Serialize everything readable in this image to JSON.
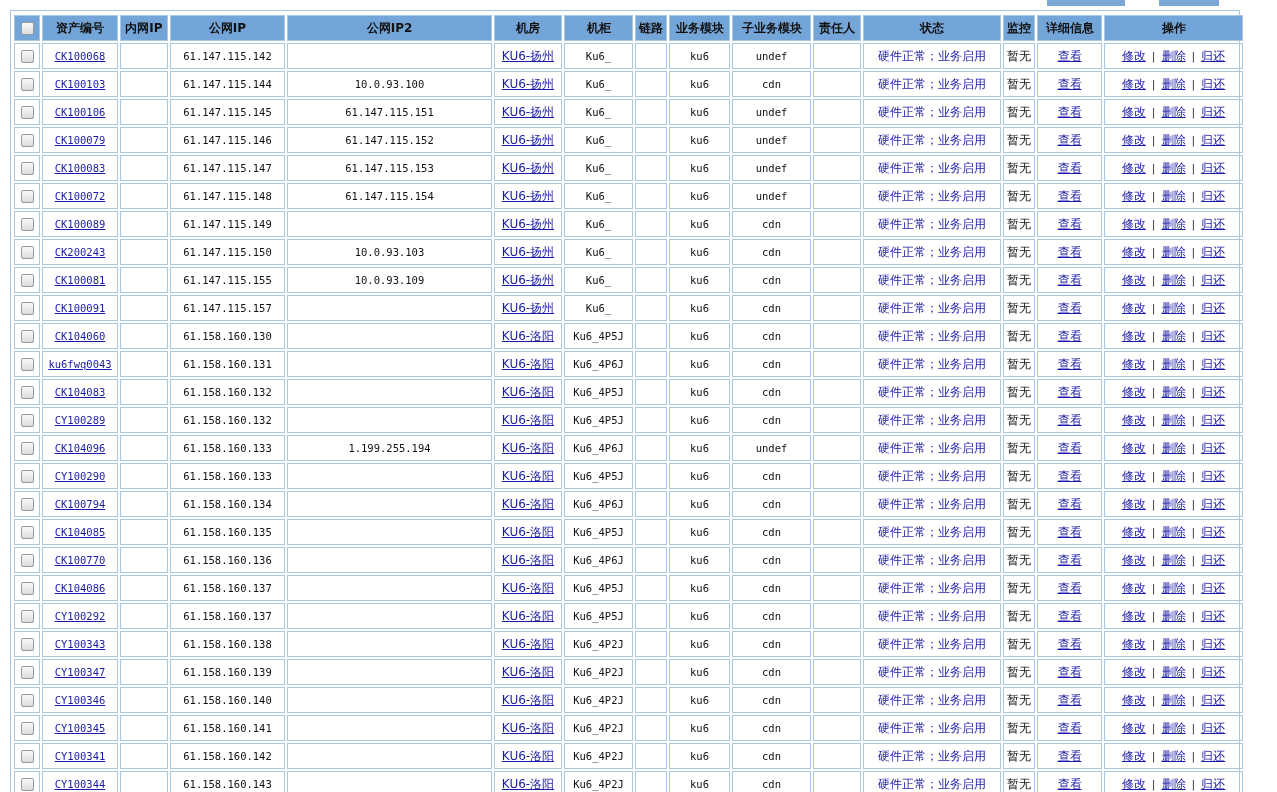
{
  "toolbar": {
    "buttons": [
      {
        "kind": "button"
      },
      {
        "kind": "button"
      }
    ]
  },
  "table": {
    "header_checkbox": {
      "checked": false
    },
    "columns": [
      "资产编号",
      "内网IP",
      "公网IP",
      "公网IP2",
      "机房",
      "机柜",
      "链路",
      "业务模块",
      "子业务模块",
      "责任人",
      "状态",
      "监控",
      "详细信息",
      "操作"
    ],
    "rows": [
      {
        "checked": false,
        "asset": "CK100068",
        "public_ip": "61.147.115.142",
        "public_ip2": "",
        "room": "KU6-扬州",
        "cabinet": "Ku6_",
        "module": "ku6",
        "sub_module": "undef",
        "status": "硬件正常；业务启用",
        "monitor": "暂无",
        "detail": "查看",
        "actions": [
          {
            "kind": "link",
            "text": "修改"
          },
          {
            "kind": "sep",
            "text": "|"
          },
          {
            "kind": "link",
            "text": "删除"
          },
          {
            "kind": "sep",
            "text": "|"
          },
          {
            "kind": "link",
            "text": "归还"
          }
        ]
      },
      {
        "checked": false,
        "asset": "CK100103",
        "public_ip": "61.147.115.144",
        "public_ip2": "10.0.93.100",
        "room": "KU6-扬州",
        "cabinet": "Ku6_",
        "module": "ku6",
        "sub_module": "cdn",
        "status": "硬件正常；业务启用",
        "monitor": "暂无",
        "detail": "查看",
        "actions": [
          {
            "kind": "link",
            "text": "修改"
          },
          {
            "kind": "sep",
            "text": "|"
          },
          {
            "kind": "link",
            "text": "删除"
          },
          {
            "kind": "sep",
            "text": "|"
          },
          {
            "kind": "link",
            "text": "归还"
          }
        ]
      },
      {
        "checked": false,
        "asset": "CK100106",
        "public_ip": "61.147.115.145",
        "public_ip2": "61.147.115.151",
        "room": "KU6-扬州",
        "cabinet": "Ku6_",
        "module": "ku6",
        "sub_module": "undef",
        "status": "硬件正常；业务启用",
        "monitor": "暂无",
        "detail": "查看",
        "actions": [
          {
            "kind": "link",
            "text": "修改"
          },
          {
            "kind": "sep",
            "text": "|"
          },
          {
            "kind": "link",
            "text": "删除"
          },
          {
            "kind": "sep",
            "text": "|"
          },
          {
            "kind": "link",
            "text": "归还"
          }
        ]
      },
      {
        "checked": false,
        "asset": "CK100079",
        "public_ip": "61.147.115.146",
        "public_ip2": "61.147.115.152",
        "room": "KU6-扬州",
        "cabinet": "Ku6_",
        "module": "ku6",
        "sub_module": "undef",
        "status": "硬件正常；业务启用",
        "monitor": "暂无",
        "detail": "查看",
        "actions": [
          {
            "kind": "link",
            "text": "修改"
          },
          {
            "kind": "sep",
            "text": "|"
          },
          {
            "kind": "link",
            "text": "删除"
          },
          {
            "kind": "sep",
            "text": "|"
          },
          {
            "kind": "link",
            "text": "归还"
          }
        ]
      },
      {
        "checked": false,
        "asset": "CK100083",
        "public_ip": "61.147.115.147",
        "public_ip2": "61.147.115.153",
        "room": "KU6-扬州",
        "cabinet": "Ku6_",
        "module": "ku6",
        "sub_module": "undef",
        "status": "硬件正常；业务启用",
        "monitor": "暂无",
        "detail": "查看",
        "actions": [
          {
            "kind": "link",
            "text": "修改"
          },
          {
            "kind": "sep",
            "text": "|"
          },
          {
            "kind": "link",
            "text": "删除"
          },
          {
            "kind": "sep",
            "text": "|"
          },
          {
            "kind": "link",
            "text": "归还"
          }
        ]
      },
      {
        "checked": false,
        "asset": "CK100072",
        "public_ip": "61.147.115.148",
        "public_ip2": "61.147.115.154",
        "room": "KU6-扬州",
        "cabinet": "Ku6_",
        "module": "ku6",
        "sub_module": "undef",
        "status": "硬件正常；业务启用",
        "monitor": "暂无",
        "detail": "查看",
        "actions": [
          {
            "kind": "link",
            "text": "修改"
          },
          {
            "kind": "sep",
            "text": "|"
          },
          {
            "kind": "link",
            "text": "删除"
          },
          {
            "kind": "sep",
            "text": "|"
          },
          {
            "kind": "link",
            "text": "归还"
          }
        ]
      },
      {
        "checked": false,
        "asset": "CK100089",
        "public_ip": "61.147.115.149",
        "public_ip2": "",
        "room": "KU6-扬州",
        "cabinet": "Ku6_",
        "module": "ku6",
        "sub_module": "cdn",
        "status": "硬件正常；业务启用",
        "monitor": "暂无",
        "detail": "查看",
        "actions": [
          {
            "kind": "link",
            "text": "修改"
          },
          {
            "kind": "sep",
            "text": "|"
          },
          {
            "kind": "link",
            "text": "删除"
          },
          {
            "kind": "sep",
            "text": "|"
          },
          {
            "kind": "link",
            "text": "归还"
          }
        ]
      },
      {
        "checked": false,
        "asset": "CK200243",
        "public_ip": "61.147.115.150",
        "public_ip2": "10.0.93.103",
        "room": "KU6-扬州",
        "cabinet": "Ku6_",
        "module": "ku6",
        "sub_module": "cdn",
        "status": "硬件正常；业务启用",
        "monitor": "暂无",
        "detail": "查看",
        "actions": [
          {
            "kind": "link",
            "text": "修改"
          },
          {
            "kind": "sep",
            "text": "|"
          },
          {
            "kind": "link",
            "text": "删除"
          },
          {
            "kind": "sep",
            "text": "|"
          },
          {
            "kind": "link",
            "text": "归还"
          }
        ]
      },
      {
        "checked": false,
        "asset": "CK100081",
        "public_ip": "61.147.115.155",
        "public_ip2": "10.0.93.109",
        "room": "KU6-扬州",
        "cabinet": "Ku6_",
        "module": "ku6",
        "sub_module": "cdn",
        "status": "硬件正常；业务启用",
        "monitor": "暂无",
        "detail": "查看",
        "actions": [
          {
            "kind": "link",
            "text": "修改"
          },
          {
            "kind": "sep",
            "text": "|"
          },
          {
            "kind": "link",
            "text": "删除"
          },
          {
            "kind": "sep",
            "text": "|"
          },
          {
            "kind": "link",
            "text": "归还"
          }
        ]
      },
      {
        "checked": false,
        "asset": "CK100091",
        "public_ip": "61.147.115.157",
        "public_ip2": "",
        "room": "KU6-扬州",
        "cabinet": "Ku6_",
        "module": "ku6",
        "sub_module": "cdn",
        "status": "硬件正常；业务启用",
        "monitor": "暂无",
        "detail": "查看",
        "actions": [
          {
            "kind": "link",
            "text": "修改"
          },
          {
            "kind": "sep",
            "text": "|"
          },
          {
            "kind": "link",
            "text": "删除"
          },
          {
            "kind": "sep",
            "text": "|"
          },
          {
            "kind": "link",
            "text": "归还"
          }
        ]
      },
      {
        "checked": false,
        "asset": "CK104060",
        "public_ip": "61.158.160.130",
        "public_ip2": "",
        "room": "KU6-洛阳",
        "cabinet": "Ku6_4P5J",
        "module": "ku6",
        "sub_module": "cdn",
        "status": "硬件正常；业务启用",
        "monitor": "暂无",
        "detail": "查看",
        "actions": [
          {
            "kind": "link",
            "text": "修改"
          },
          {
            "kind": "sep",
            "text": "|"
          },
          {
            "kind": "link",
            "text": "删除"
          },
          {
            "kind": "sep",
            "text": "|"
          },
          {
            "kind": "link",
            "text": "归还"
          }
        ]
      },
      {
        "checked": false,
        "asset": "ku6fwq0043",
        "public_ip": "61.158.160.131",
        "public_ip2": "",
        "room": "KU6-洛阳",
        "cabinet": "Ku6_4P6J",
        "module": "ku6",
        "sub_module": "cdn",
        "status": "硬件正常；业务启用",
        "monitor": "暂无",
        "detail": "查看",
        "actions": [
          {
            "kind": "link",
            "text": "修改"
          },
          {
            "kind": "sep",
            "text": "|"
          },
          {
            "kind": "link",
            "text": "删除"
          },
          {
            "kind": "sep",
            "text": "|"
          },
          {
            "kind": "link",
            "text": "归还"
          }
        ]
      },
      {
        "checked": false,
        "asset": "CK104083",
        "public_ip": "61.158.160.132",
        "public_ip2": "",
        "room": "KU6-洛阳",
        "cabinet": "Ku6_4P5J",
        "module": "ku6",
        "sub_module": "cdn",
        "status": "硬件正常；业务启用",
        "monitor": "暂无",
        "detail": "查看",
        "actions": [
          {
            "kind": "link",
            "text": "修改"
          },
          {
            "kind": "sep",
            "text": "|"
          },
          {
            "kind": "link",
            "text": "删除"
          },
          {
            "kind": "sep",
            "text": "|"
          },
          {
            "kind": "link",
            "text": "归还"
          }
        ]
      },
      {
        "checked": false,
        "asset": "CY100289",
        "public_ip": "61.158.160.132",
        "public_ip2": "",
        "room": "KU6-洛阳",
        "cabinet": "Ku6_4P5J",
        "module": "ku6",
        "sub_module": "cdn",
        "status": "硬件正常；业务启用",
        "monitor": "暂无",
        "detail": "查看",
        "actions": [
          {
            "kind": "link",
            "text": "修改"
          },
          {
            "kind": "sep",
            "text": "|"
          },
          {
            "kind": "link",
            "text": "删除"
          },
          {
            "kind": "sep",
            "text": "|"
          },
          {
            "kind": "link",
            "text": "归还"
          }
        ]
      },
      {
        "checked": false,
        "asset": "CK104096",
        "public_ip": "61.158.160.133",
        "public_ip2": "1.199.255.194",
        "room": "KU6-洛阳",
        "cabinet": "Ku6_4P6J",
        "module": "ku6",
        "sub_module": "undef",
        "status": "硬件正常；业务启用",
        "monitor": "暂无",
        "detail": "查看",
        "actions": [
          {
            "kind": "link",
            "text": "修改"
          },
          {
            "kind": "sep",
            "text": "|"
          },
          {
            "kind": "link",
            "text": "删除"
          },
          {
            "kind": "sep",
            "text": "|"
          },
          {
            "kind": "link",
            "text": "归还"
          }
        ]
      },
      {
        "checked": false,
        "asset": "CY100290",
        "public_ip": "61.158.160.133",
        "public_ip2": "",
        "room": "KU6-洛阳",
        "cabinet": "Ku6_4P5J",
        "module": "ku6",
        "sub_module": "cdn",
        "status": "硬件正常；业务启用",
        "monitor": "暂无",
        "detail": "查看",
        "actions": [
          {
            "kind": "link",
            "text": "修改"
          },
          {
            "kind": "sep",
            "text": "|"
          },
          {
            "kind": "link",
            "text": "删除"
          },
          {
            "kind": "sep",
            "text": "|"
          },
          {
            "kind": "link",
            "text": "归还"
          }
        ]
      },
      {
        "checked": false,
        "asset": "CK100794",
        "public_ip": "61.158.160.134",
        "public_ip2": "",
        "room": "KU6-洛阳",
        "cabinet": "Ku6_4P6J",
        "module": "ku6",
        "sub_module": "cdn",
        "status": "硬件正常；业务启用",
        "monitor": "暂无",
        "detail": "查看",
        "actions": [
          {
            "kind": "link",
            "text": "修改"
          },
          {
            "kind": "sep",
            "text": "|"
          },
          {
            "kind": "link",
            "text": "删除"
          },
          {
            "kind": "sep",
            "text": "|"
          },
          {
            "kind": "link",
            "text": "归还"
          }
        ]
      },
      {
        "checked": false,
        "asset": "CK104085",
        "public_ip": "61.158.160.135",
        "public_ip2": "",
        "room": "KU6-洛阳",
        "cabinet": "Ku6_4P5J",
        "module": "ku6",
        "sub_module": "cdn",
        "status": "硬件正常；业务启用",
        "monitor": "暂无",
        "detail": "查看",
        "actions": [
          {
            "kind": "link",
            "text": "修改"
          },
          {
            "kind": "sep",
            "text": "|"
          },
          {
            "kind": "link",
            "text": "删除"
          },
          {
            "kind": "sep",
            "text": "|"
          },
          {
            "kind": "link",
            "text": "归还"
          }
        ]
      },
      {
        "checked": false,
        "asset": "CK100770",
        "public_ip": "61.158.160.136",
        "public_ip2": "",
        "room": "KU6-洛阳",
        "cabinet": "Ku6_4P6J",
        "module": "ku6",
        "sub_module": "cdn",
        "status": "硬件正常；业务启用",
        "monitor": "暂无",
        "detail": "查看",
        "actions": [
          {
            "kind": "link",
            "text": "修改"
          },
          {
            "kind": "sep",
            "text": "|"
          },
          {
            "kind": "link",
            "text": "删除"
          },
          {
            "kind": "sep",
            "text": "|"
          },
          {
            "kind": "link",
            "text": "归还"
          }
        ]
      },
      {
        "checked": false,
        "asset": "CK104086",
        "public_ip": "61.158.160.137",
        "public_ip2": "",
        "room": "KU6-洛阳",
        "cabinet": "Ku6_4P5J",
        "module": "ku6",
        "sub_module": "cdn",
        "status": "硬件正常；业务启用",
        "monitor": "暂无",
        "detail": "查看",
        "actions": [
          {
            "kind": "link",
            "text": "修改"
          },
          {
            "kind": "sep",
            "text": "|"
          },
          {
            "kind": "link",
            "text": "删除"
          },
          {
            "kind": "sep",
            "text": "|"
          },
          {
            "kind": "link",
            "text": "归还"
          }
        ]
      },
      {
        "checked": false,
        "asset": "CY100292",
        "public_ip": "61.158.160.137",
        "public_ip2": "",
        "room": "KU6-洛阳",
        "cabinet": "Ku6_4P5J",
        "module": "ku6",
        "sub_module": "cdn",
        "status": "硬件正常；业务启用",
        "monitor": "暂无",
        "detail": "查看",
        "actions": [
          {
            "kind": "link",
            "text": "修改"
          },
          {
            "kind": "sep",
            "text": "|"
          },
          {
            "kind": "link",
            "text": "删除"
          },
          {
            "kind": "sep",
            "text": "|"
          },
          {
            "kind": "link",
            "text": "归还"
          }
        ]
      },
      {
        "checked": false,
        "asset": "CY100343",
        "public_ip": "61.158.160.138",
        "public_ip2": "",
        "room": "KU6-洛阳",
        "cabinet": "Ku6_4P2J",
        "module": "ku6",
        "sub_module": "cdn",
        "status": "硬件正常；业务启用",
        "monitor": "暂无",
        "detail": "查看",
        "actions": [
          {
            "kind": "link",
            "text": "修改"
          },
          {
            "kind": "sep",
            "text": "|"
          },
          {
            "kind": "link",
            "text": "删除"
          },
          {
            "kind": "sep",
            "text": "|"
          },
          {
            "kind": "link",
            "text": "归还"
          }
        ]
      },
      {
        "checked": false,
        "asset": "CY100347",
        "public_ip": "61.158.160.139",
        "public_ip2": "",
        "room": "KU6-洛阳",
        "cabinet": "Ku6_4P2J",
        "module": "ku6",
        "sub_module": "cdn",
        "status": "硬件正常；业务启用",
        "monitor": "暂无",
        "detail": "查看",
        "actions": [
          {
            "kind": "link",
            "text": "修改"
          },
          {
            "kind": "sep",
            "text": "|"
          },
          {
            "kind": "link",
            "text": "删除"
          },
          {
            "kind": "sep",
            "text": "|"
          },
          {
            "kind": "link",
            "text": "归还"
          }
        ]
      },
      {
        "checked": false,
        "asset": "CY100346",
        "public_ip": "61.158.160.140",
        "public_ip2": "",
        "room": "KU6-洛阳",
        "cabinet": "Ku6_4P2J",
        "module": "ku6",
        "sub_module": "cdn",
        "status": "硬件正常；业务启用",
        "monitor": "暂无",
        "detail": "查看",
        "actions": [
          {
            "kind": "link",
            "text": "修改"
          },
          {
            "kind": "sep",
            "text": "|"
          },
          {
            "kind": "link",
            "text": "删除"
          },
          {
            "kind": "sep",
            "text": "|"
          },
          {
            "kind": "link",
            "text": "归还"
          }
        ]
      },
      {
        "checked": false,
        "asset": "CY100345",
        "public_ip": "61.158.160.141",
        "public_ip2": "",
        "room": "KU6-洛阳",
        "cabinet": "Ku6_4P2J",
        "module": "ku6",
        "sub_module": "cdn",
        "status": "硬件正常；业务启用",
        "monitor": "暂无",
        "detail": "查看",
        "actions": [
          {
            "kind": "link",
            "text": "修改"
          },
          {
            "kind": "sep",
            "text": "|"
          },
          {
            "kind": "link",
            "text": "删除"
          },
          {
            "kind": "sep",
            "text": "|"
          },
          {
            "kind": "link",
            "text": "归还"
          }
        ]
      },
      {
        "checked": false,
        "asset": "CY100341",
        "public_ip": "61.158.160.142",
        "public_ip2": "",
        "room": "KU6-洛阳",
        "cabinet": "Ku6_4P2J",
        "module": "ku6",
        "sub_module": "cdn",
        "status": "硬件正常；业务启用",
        "monitor": "暂无",
        "detail": "查看",
        "actions": [
          {
            "kind": "link",
            "text": "修改"
          },
          {
            "kind": "sep",
            "text": "|"
          },
          {
            "kind": "link",
            "text": "删除"
          },
          {
            "kind": "sep",
            "text": "|"
          },
          {
            "kind": "link",
            "text": "归还"
          }
        ]
      },
      {
        "checked": false,
        "asset": "CY100344",
        "public_ip": "61.158.160.143",
        "public_ip2": "",
        "room": "KU6-洛阳",
        "cabinet": "Ku6_4P2J",
        "module": "ku6",
        "sub_module": "cdn",
        "status": "硬件正常；业务启用",
        "monitor": "暂无",
        "detail": "查看",
        "actions": [
          {
            "kind": "link",
            "text": "修改"
          },
          {
            "kind": "sep",
            "text": "|"
          },
          {
            "kind": "link",
            "text": "删除"
          },
          {
            "kind": "sep",
            "text": "|"
          },
          {
            "kind": "link",
            "text": "归还"
          }
        ]
      }
    ]
  }
}
